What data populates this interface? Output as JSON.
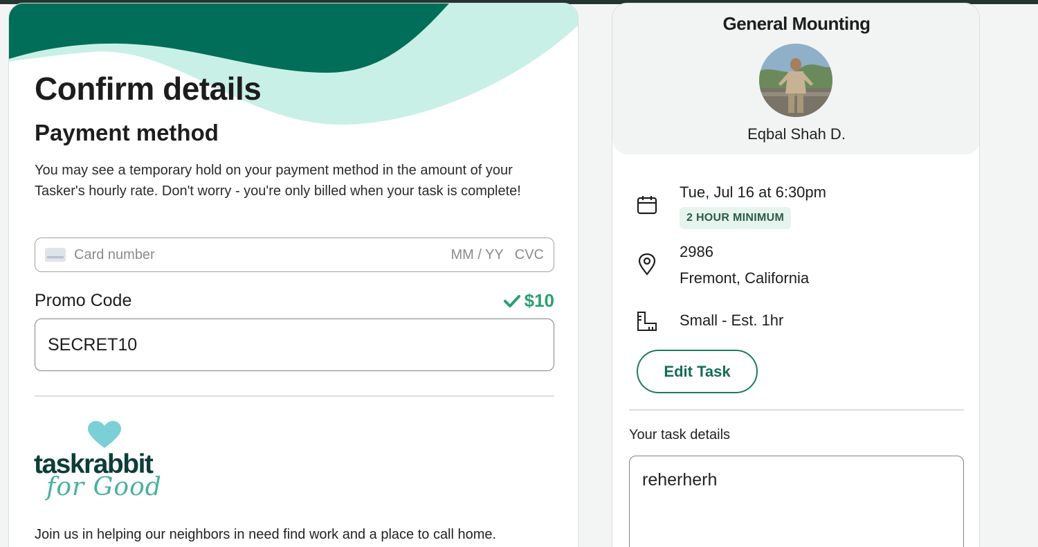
{
  "confirm": {
    "title": "Confirm details",
    "payment_heading": "Payment method",
    "payment_description": "You may see a temporary hold on your payment method in the amount of your Tasker's hourly rate. Don't worry - you're only billed when your task is complete!",
    "card_input": {
      "placeholder": "Card number",
      "expiry_placeholder": "MM / YY",
      "cvc_placeholder": "CVC"
    },
    "promo": {
      "label": "Promo Code",
      "discount": "$10",
      "value": "SECRET10"
    },
    "charity": {
      "logo_text": "taskrabbit",
      "logo_script": "for Good",
      "message": "Join us in helping our neighbors in need find work and a place to call home."
    }
  },
  "summary": {
    "task_title": "General Mounting",
    "tasker_name": "Eqbal Shah D.",
    "date": "Tue, Jul 16 at 6:30pm",
    "badge": "2 HOUR MINIMUM",
    "address_line1": "2986",
    "address_line2": "Fremont, California",
    "size": "Small - Est. 1hr",
    "edit_button": "Edit Task",
    "details_label": "Your task details",
    "details_value": "reherherh"
  },
  "icons": {
    "date": "calendar-icon",
    "location": "map-pin-icon",
    "size": "ruler-icon",
    "promo_valid": "check-icon",
    "card": "credit-card-icon",
    "logo": "heart-icon"
  },
  "colors": {
    "brand_dark": "#006e58",
    "brand_light": "#c9f0e6",
    "success": "#2aa06f",
    "badge_bg": "#e6f4ee"
  }
}
